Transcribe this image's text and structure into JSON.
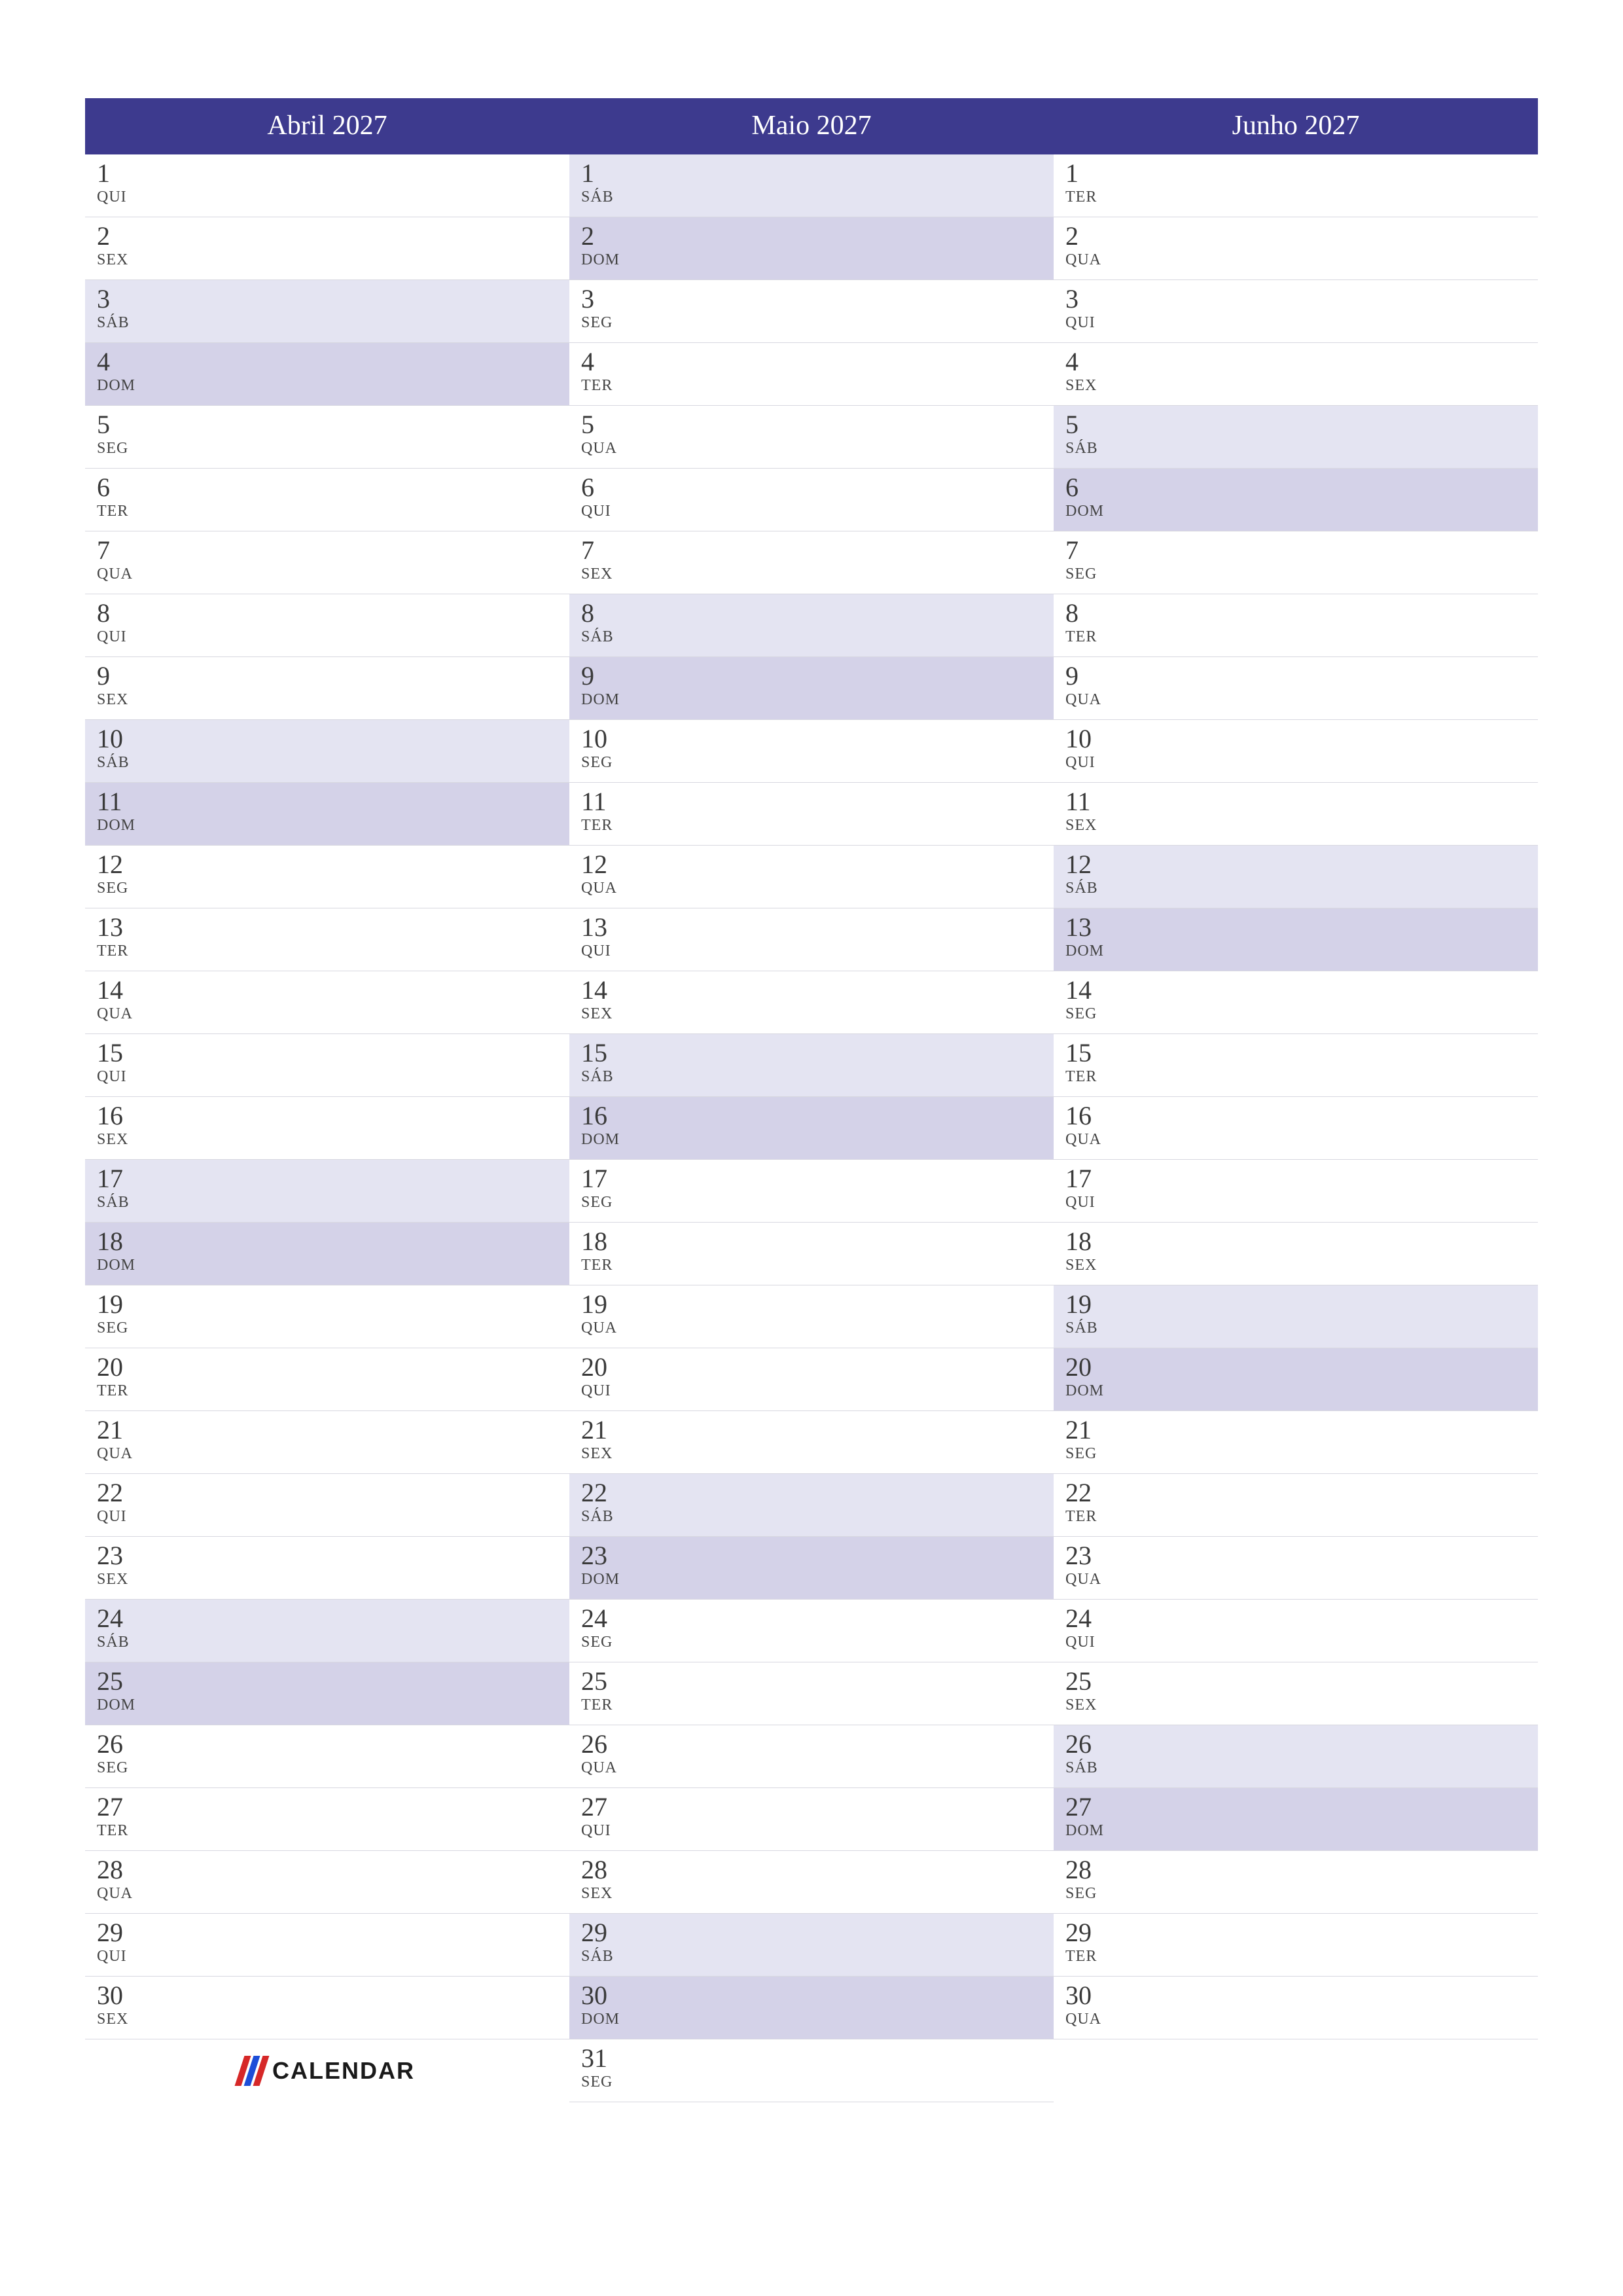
{
  "brand": {
    "name": "CALENDAR"
  },
  "weekday_abbrs": [
    "SEG",
    "TER",
    "QUA",
    "QUI",
    "SEX",
    "SÁB",
    "DOM"
  ],
  "months": [
    {
      "title": "Abril 2027",
      "days": [
        {
          "n": "1",
          "w": "QUI",
          "t": "wd"
        },
        {
          "n": "2",
          "w": "SEX",
          "t": "wd"
        },
        {
          "n": "3",
          "w": "SÁB",
          "t": "sat"
        },
        {
          "n": "4",
          "w": "DOM",
          "t": "sun"
        },
        {
          "n": "5",
          "w": "SEG",
          "t": "wd"
        },
        {
          "n": "6",
          "w": "TER",
          "t": "wd"
        },
        {
          "n": "7",
          "w": "QUA",
          "t": "wd"
        },
        {
          "n": "8",
          "w": "QUI",
          "t": "wd"
        },
        {
          "n": "9",
          "w": "SEX",
          "t": "wd"
        },
        {
          "n": "10",
          "w": "SÁB",
          "t": "sat"
        },
        {
          "n": "11",
          "w": "DOM",
          "t": "sun"
        },
        {
          "n": "12",
          "w": "SEG",
          "t": "wd"
        },
        {
          "n": "13",
          "w": "TER",
          "t": "wd"
        },
        {
          "n": "14",
          "w": "QUA",
          "t": "wd"
        },
        {
          "n": "15",
          "w": "QUI",
          "t": "wd"
        },
        {
          "n": "16",
          "w": "SEX",
          "t": "wd"
        },
        {
          "n": "17",
          "w": "SÁB",
          "t": "sat"
        },
        {
          "n": "18",
          "w": "DOM",
          "t": "sun"
        },
        {
          "n": "19",
          "w": "SEG",
          "t": "wd"
        },
        {
          "n": "20",
          "w": "TER",
          "t": "wd"
        },
        {
          "n": "21",
          "w": "QUA",
          "t": "wd"
        },
        {
          "n": "22",
          "w": "QUI",
          "t": "wd"
        },
        {
          "n": "23",
          "w": "SEX",
          "t": "wd"
        },
        {
          "n": "24",
          "w": "SÁB",
          "t": "sat"
        },
        {
          "n": "25",
          "w": "DOM",
          "t": "sun"
        },
        {
          "n": "26",
          "w": "SEG",
          "t": "wd"
        },
        {
          "n": "27",
          "w": "TER",
          "t": "wd"
        },
        {
          "n": "28",
          "w": "QUA",
          "t": "wd"
        },
        {
          "n": "29",
          "w": "QUI",
          "t": "wd"
        },
        {
          "n": "30",
          "w": "SEX",
          "t": "wd"
        }
      ]
    },
    {
      "title": "Maio 2027",
      "days": [
        {
          "n": "1",
          "w": "SÁB",
          "t": "sat"
        },
        {
          "n": "2",
          "w": "DOM",
          "t": "sun"
        },
        {
          "n": "3",
          "w": "SEG",
          "t": "wd"
        },
        {
          "n": "4",
          "w": "TER",
          "t": "wd"
        },
        {
          "n": "5",
          "w": "QUA",
          "t": "wd"
        },
        {
          "n": "6",
          "w": "QUI",
          "t": "wd"
        },
        {
          "n": "7",
          "w": "SEX",
          "t": "wd"
        },
        {
          "n": "8",
          "w": "SÁB",
          "t": "sat"
        },
        {
          "n": "9",
          "w": "DOM",
          "t": "sun"
        },
        {
          "n": "10",
          "w": "SEG",
          "t": "wd"
        },
        {
          "n": "11",
          "w": "TER",
          "t": "wd"
        },
        {
          "n": "12",
          "w": "QUA",
          "t": "wd"
        },
        {
          "n": "13",
          "w": "QUI",
          "t": "wd"
        },
        {
          "n": "14",
          "w": "SEX",
          "t": "wd"
        },
        {
          "n": "15",
          "w": "SÁB",
          "t": "sat"
        },
        {
          "n": "16",
          "w": "DOM",
          "t": "sun"
        },
        {
          "n": "17",
          "w": "SEG",
          "t": "wd"
        },
        {
          "n": "18",
          "w": "TER",
          "t": "wd"
        },
        {
          "n": "19",
          "w": "QUA",
          "t": "wd"
        },
        {
          "n": "20",
          "w": "QUI",
          "t": "wd"
        },
        {
          "n": "21",
          "w": "SEX",
          "t": "wd"
        },
        {
          "n": "22",
          "w": "SÁB",
          "t": "sat"
        },
        {
          "n": "23",
          "w": "DOM",
          "t": "sun"
        },
        {
          "n": "24",
          "w": "SEG",
          "t": "wd"
        },
        {
          "n": "25",
          "w": "TER",
          "t": "wd"
        },
        {
          "n": "26",
          "w": "QUA",
          "t": "wd"
        },
        {
          "n": "27",
          "w": "QUI",
          "t": "wd"
        },
        {
          "n": "28",
          "w": "SEX",
          "t": "wd"
        },
        {
          "n": "29",
          "w": "SÁB",
          "t": "sat"
        },
        {
          "n": "30",
          "w": "DOM",
          "t": "sun"
        },
        {
          "n": "31",
          "w": "SEG",
          "t": "wd"
        }
      ]
    },
    {
      "title": "Junho 2027",
      "days": [
        {
          "n": "1",
          "w": "TER",
          "t": "wd"
        },
        {
          "n": "2",
          "w": "QUA",
          "t": "wd"
        },
        {
          "n": "3",
          "w": "QUI",
          "t": "wd"
        },
        {
          "n": "4",
          "w": "SEX",
          "t": "wd"
        },
        {
          "n": "5",
          "w": "SÁB",
          "t": "sat"
        },
        {
          "n": "6",
          "w": "DOM",
          "t": "sun"
        },
        {
          "n": "7",
          "w": "SEG",
          "t": "wd"
        },
        {
          "n": "8",
          "w": "TER",
          "t": "wd"
        },
        {
          "n": "9",
          "w": "QUA",
          "t": "wd"
        },
        {
          "n": "10",
          "w": "QUI",
          "t": "wd"
        },
        {
          "n": "11",
          "w": "SEX",
          "t": "wd"
        },
        {
          "n": "12",
          "w": "SÁB",
          "t": "sat"
        },
        {
          "n": "13",
          "w": "DOM",
          "t": "sun"
        },
        {
          "n": "14",
          "w": "SEG",
          "t": "wd"
        },
        {
          "n": "15",
          "w": "TER",
          "t": "wd"
        },
        {
          "n": "16",
          "w": "QUA",
          "t": "wd"
        },
        {
          "n": "17",
          "w": "QUI",
          "t": "wd"
        },
        {
          "n": "18",
          "w": "SEX",
          "t": "wd"
        },
        {
          "n": "19",
          "w": "SÁB",
          "t": "sat"
        },
        {
          "n": "20",
          "w": "DOM",
          "t": "sun"
        },
        {
          "n": "21",
          "w": "SEG",
          "t": "wd"
        },
        {
          "n": "22",
          "w": "TER",
          "t": "wd"
        },
        {
          "n": "23",
          "w": "QUA",
          "t": "wd"
        },
        {
          "n": "24",
          "w": "QUI",
          "t": "wd"
        },
        {
          "n": "25",
          "w": "SEX",
          "t": "wd"
        },
        {
          "n": "26",
          "w": "SÁB",
          "t": "sat"
        },
        {
          "n": "27",
          "w": "DOM",
          "t": "sun"
        },
        {
          "n": "28",
          "w": "SEG",
          "t": "wd"
        },
        {
          "n": "29",
          "w": "TER",
          "t": "wd"
        },
        {
          "n": "30",
          "w": "QUA",
          "t": "wd"
        }
      ]
    }
  ]
}
